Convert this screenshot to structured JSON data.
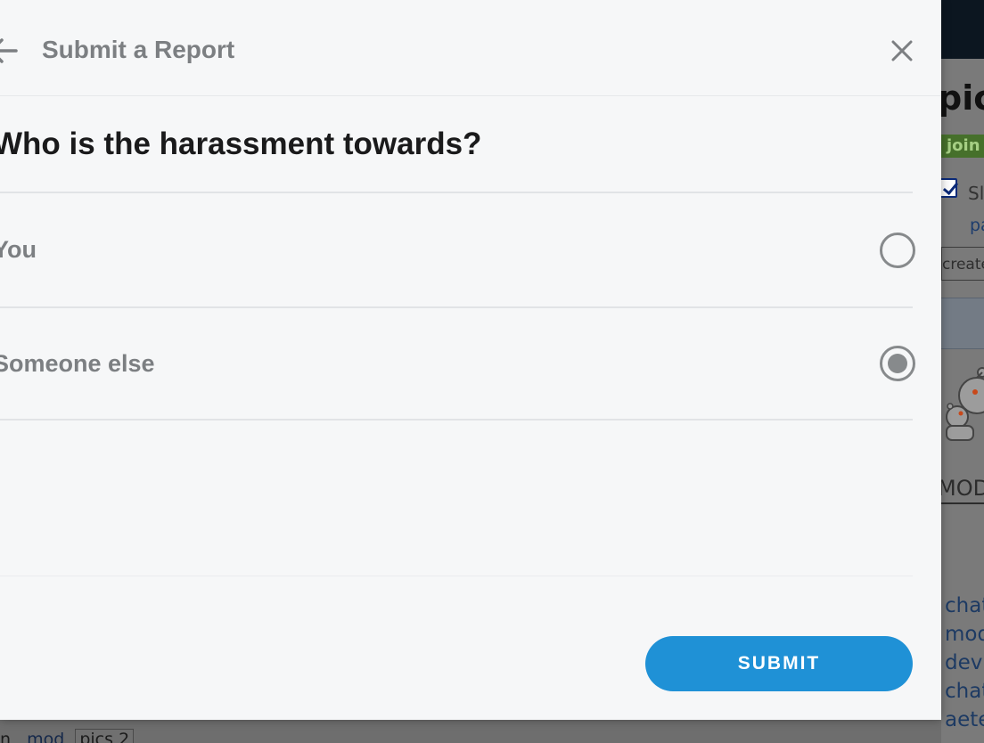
{
  "modal": {
    "title": "Submit a Report",
    "question": "Who is the harassment towards?",
    "options": [
      {
        "label": "You",
        "selected": false
      },
      {
        "label": "Someone else",
        "selected": true
      }
    ],
    "submit_label": "SUBMIT",
    "accent_color": "#1f91d6"
  },
  "background": {
    "title_fragment": "pic",
    "join_fragment": "join",
    "checkbox_label_fragment": "Sl",
    "link_fragment": "pa",
    "create_fragment": "create",
    "mod_fragment": "MOD",
    "links": [
      "chat",
      "mod",
      "dev",
      "chat",
      "aete"
    ],
    "bottom_tags": {
      "left_fragment": "n",
      "mod": "mod",
      "pics": "pics 2"
    }
  }
}
